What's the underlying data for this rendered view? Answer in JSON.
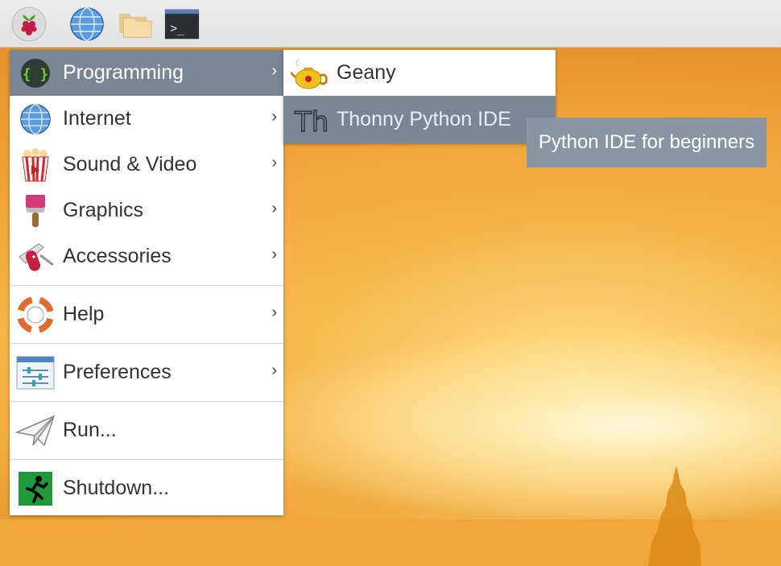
{
  "taskbar": {
    "buttons": [
      {
        "name": "raspberry-pi-menu-button",
        "icon": "raspberry-icon"
      },
      {
        "name": "web-browser-button",
        "icon": "globe-icon"
      },
      {
        "name": "file-manager-button",
        "icon": "folder-icon"
      },
      {
        "name": "terminal-button",
        "icon": "terminal-icon",
        "glyph": ">_"
      }
    ]
  },
  "menu": {
    "items": [
      {
        "label": "Programming",
        "icon": "braces-icon",
        "glyph": "{ }",
        "arrow": "›"
      },
      {
        "label": "Internet",
        "icon": "globe-icon",
        "arrow": "›"
      },
      {
        "label": "Sound & Video",
        "icon": "popcorn-icon",
        "arrow": "›"
      },
      {
        "label": "Graphics",
        "icon": "paintbrush-icon",
        "arrow": "›"
      },
      {
        "label": "Accessories",
        "icon": "pocketknife-icon",
        "arrow": "›"
      },
      {
        "label": "Help",
        "icon": "lifebuoy-icon",
        "arrow": "›"
      },
      {
        "label": "Preferences",
        "icon": "sliders-icon",
        "arrow": "›"
      },
      {
        "label": "Run...",
        "icon": "paper-plane-icon"
      },
      {
        "label": "Shutdown...",
        "icon": "exit-running-man-icon"
      }
    ]
  },
  "submenu": {
    "items": [
      {
        "label": "Geany",
        "icon": "teapot-icon"
      },
      {
        "label": "Thonny Python IDE",
        "icon": "thonny-icon",
        "glyph": "Th"
      }
    ]
  },
  "tooltip": {
    "text": "Python IDE for beginners"
  },
  "colors": {
    "highlight": "#7b8693",
    "tooltip": "#8b95a2",
    "menu_bg": "#ffffff"
  }
}
